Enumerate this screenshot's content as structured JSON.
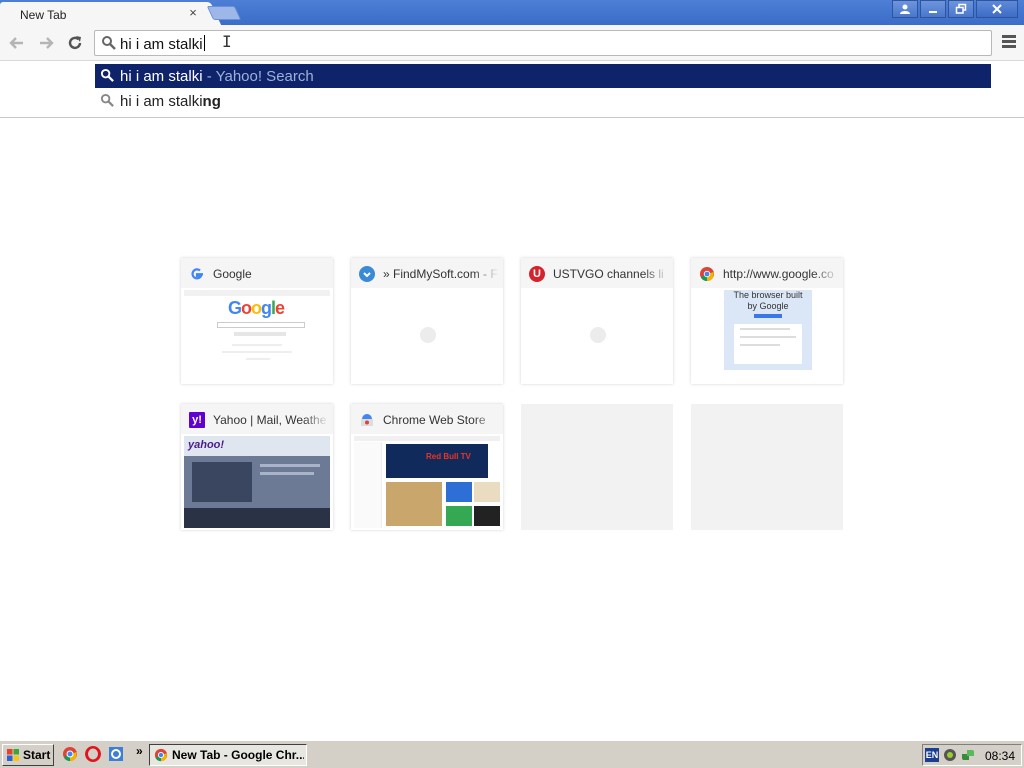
{
  "browser": {
    "tab": {
      "title": "New Tab",
      "close_glyph": "×"
    },
    "window_controls": {
      "user": "⍝",
      "minimize": "—",
      "restore": "❐",
      "close": "X"
    }
  },
  "toolbar": {
    "back_glyph": "←",
    "forward_glyph": "→",
    "reload_glyph": "↻",
    "omnibox_value": "hi i am stalki",
    "cursor_glyph": "I"
  },
  "suggestions": [
    {
      "text": "hi i am stalki",
      "engine_suffix": " - Yahoo! Search",
      "selected": true
    },
    {
      "text_prefix": "hi i am stalki",
      "text_bold": "ng",
      "selected": false
    }
  ],
  "most_visited": [
    {
      "title": "Google",
      "favicon": "google-icon",
      "favicon_letter": "G",
      "favicon_color": "#ffffff"
    },
    {
      "title": "» FindMySoft.com - F",
      "favicon": "findmysoft-icon",
      "favicon_letter": "",
      "favicon_color": "#3a8ad6"
    },
    {
      "title": "USTVGO channels li",
      "favicon": "ustvgo-icon",
      "favicon_letter": "U",
      "favicon_color": "#d4232a"
    },
    {
      "title": "http://www.google.co",
      "favicon": "chrome-icon",
      "favicon_letter": "",
      "favicon_color": "#e8a317"
    },
    {
      "title": "Yahoo | Mail, Weathe",
      "favicon": "yahoo-icon",
      "favicon_letter": "y!",
      "favicon_color": "#5f01d1"
    },
    {
      "title": "Chrome Web Store",
      "favicon": "webstore-icon",
      "favicon_letter": "",
      "favicon_color": "#4caf50"
    }
  ],
  "thumbs": {
    "google_logo": "Google",
    "chrome_promo": "The browser built by Google",
    "yahoo_logo": "yahoo!",
    "redbull": "Red Bull TV"
  },
  "taskbar": {
    "start_label": "Start",
    "more_glyph": "»",
    "task_label": "New Tab - Google Chr...",
    "lang": "EN",
    "clock": "08:34"
  }
}
